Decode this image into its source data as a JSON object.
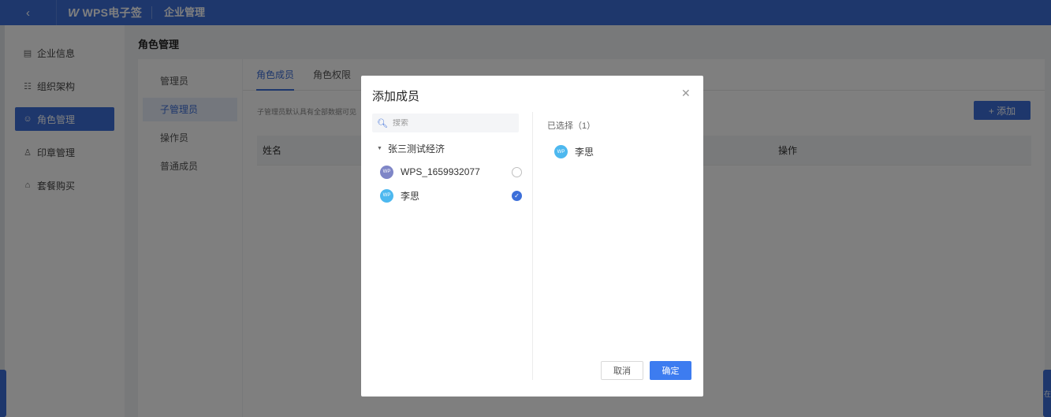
{
  "header": {
    "back_icon": "chevron-left-icon",
    "brand_logo": "W",
    "brand": "WPS电子签",
    "title": "企业管理"
  },
  "sidebar": {
    "items": [
      {
        "label": "企业信息",
        "icon": "building-icon",
        "active": false
      },
      {
        "label": "组织架构",
        "icon": "org-chart-icon",
        "active": false
      },
      {
        "label": "角色管理",
        "icon": "user-role-icon",
        "active": true
      },
      {
        "label": "印章管理",
        "icon": "seal-icon",
        "active": false
      },
      {
        "label": "套餐购买",
        "icon": "cart-icon",
        "active": false
      }
    ]
  },
  "main": {
    "page_title": "角色管理",
    "roles": [
      {
        "label": "管理员",
        "active": false
      },
      {
        "label": "子管理员",
        "active": true
      },
      {
        "label": "操作员",
        "active": false
      },
      {
        "label": "普通成员",
        "active": false
      }
    ],
    "tabs": [
      {
        "label": "角色成员",
        "active": true
      },
      {
        "label": "角色权限",
        "active": false
      }
    ],
    "hint": "子管理员默认具有全部数据可见",
    "add_button": "+ 添加",
    "table_headers": [
      "姓名",
      "操作"
    ]
  },
  "side_float_right": "在",
  "modal": {
    "title": "添加成员",
    "close_icon": "close-icon",
    "search_placeholder": "搜索",
    "department": "张三测试经济",
    "members": [
      {
        "avatar": "WP",
        "name": "WPS_1659932077",
        "checked": false,
        "color": "#7f86c7"
      },
      {
        "avatar": "WP",
        "name": "李思",
        "checked": true,
        "color": "#4db8ef"
      }
    ],
    "selected_title": "已选择（1）",
    "selected": [
      {
        "avatar": "WP",
        "name": "李思"
      }
    ],
    "cancel": "取消",
    "confirm": "确定"
  },
  "colors": {
    "accent": "#3d6fd9",
    "confirm": "#3d7cf0",
    "overlay": "rgba(0,0,0,0.5)"
  }
}
